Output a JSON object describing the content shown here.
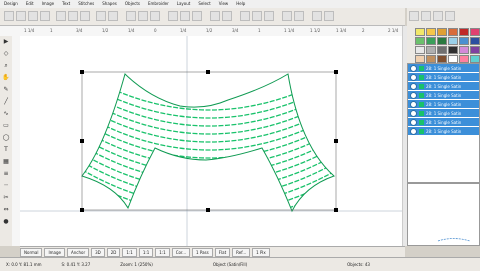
{
  "menu": [
    "Design",
    "Edit",
    "Image",
    "Text",
    "Stitches",
    "Shapes",
    "Objects",
    "Embroider",
    "Layout",
    "Select",
    "View",
    "Help"
  ],
  "ruler_top": [
    "1 1/4",
    "1",
    "3/4",
    "1/2",
    "1/4",
    "0",
    "1/4",
    "1/2",
    "3/4",
    "1",
    "1 1/4",
    "1 1/2",
    "1 3/4",
    "2",
    "2 1/4"
  ],
  "objects_list": [
    {
      "label": "28: 1 Single Satin",
      "selected": true
    },
    {
      "label": "28: 1 Single Satin",
      "selected": true
    },
    {
      "label": "28: 1 Single Satin",
      "selected": true
    },
    {
      "label": "28: 1 Single Satin",
      "selected": true
    },
    {
      "label": "28: 1 Single Satin",
      "selected": true
    },
    {
      "label": "28: 1 Single Satin",
      "selected": true
    },
    {
      "label": "28: 1 Single Satin",
      "selected": true
    },
    {
      "label": "28: 1 Single Satin",
      "selected": true
    }
  ],
  "palette_colors": [
    "#f2e86a",
    "#f5c64a",
    "#e0a034",
    "#d86b3a",
    "#c02828",
    "#e04070",
    "#6cc06c",
    "#3aa05a",
    "#2a7a40",
    "#9ad0e8",
    "#4c8fd0",
    "#2c4fa0",
    "#e8e8e8",
    "#b0b0b0",
    "#707070",
    "#303030",
    "#d48ad8",
    "#8040a0",
    "#f0d0b0",
    "#c09060",
    "#805030",
    "#ffffff",
    "#ff80a0",
    "#60d0d0"
  ],
  "tabs": [
    "Normal",
    "Image",
    "Anchor",
    "3D",
    "2D",
    "1:1",
    "1:1",
    "1:1",
    "Cor...",
    "1 Pass",
    "Flat",
    "Ref...",
    "1 Pix"
  ],
  "status": {
    "coords": "X: 0.0  Y: 81.1 mm",
    "stitches": "S: 0.41  Y: 3.27",
    "zoom": "Zoom: 1 (250%)",
    "object": "Object (Satin/Fill)",
    "count": "Objects: 43"
  },
  "accent": "#19c26b",
  "selection_blue": "#3c8fd9"
}
